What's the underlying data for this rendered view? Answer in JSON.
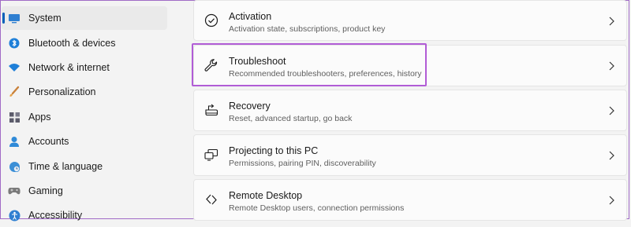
{
  "sidebar": {
    "items": [
      {
        "label": "System",
        "icon": "monitor-icon",
        "selected": true
      },
      {
        "label": "Bluetooth & devices",
        "icon": "bluetooth-icon"
      },
      {
        "label": "Network & internet",
        "icon": "wifi-icon"
      },
      {
        "label": "Personalization",
        "icon": "brush-icon"
      },
      {
        "label": "Apps",
        "icon": "apps-icon"
      },
      {
        "label": "Accounts",
        "icon": "person-icon"
      },
      {
        "label": "Time & language",
        "icon": "globe-clock-icon"
      },
      {
        "label": "Gaming",
        "icon": "gamepad-icon"
      },
      {
        "label": "Accessibility",
        "icon": "accessibility-icon"
      }
    ]
  },
  "cards": [
    {
      "title": "Activation",
      "subtitle": "Activation state, subscriptions, product key",
      "icon": "check-circle-icon"
    },
    {
      "title": "Troubleshoot",
      "subtitle": "Recommended troubleshooters, preferences, history",
      "icon": "wrench-icon"
    },
    {
      "title": "Recovery",
      "subtitle": "Reset, advanced startup, go back",
      "icon": "recovery-icon"
    },
    {
      "title": "Projecting to this PC",
      "subtitle": "Permissions, pairing PIN, discoverability",
      "icon": "projecting-icon"
    },
    {
      "title": "Remote Desktop",
      "subtitle": "Remote Desktop users, connection permissions",
      "icon": "remote-desktop-icon"
    }
  ],
  "colors": {
    "accent": "#005fb8",
    "highlight": "#b15cd6"
  }
}
